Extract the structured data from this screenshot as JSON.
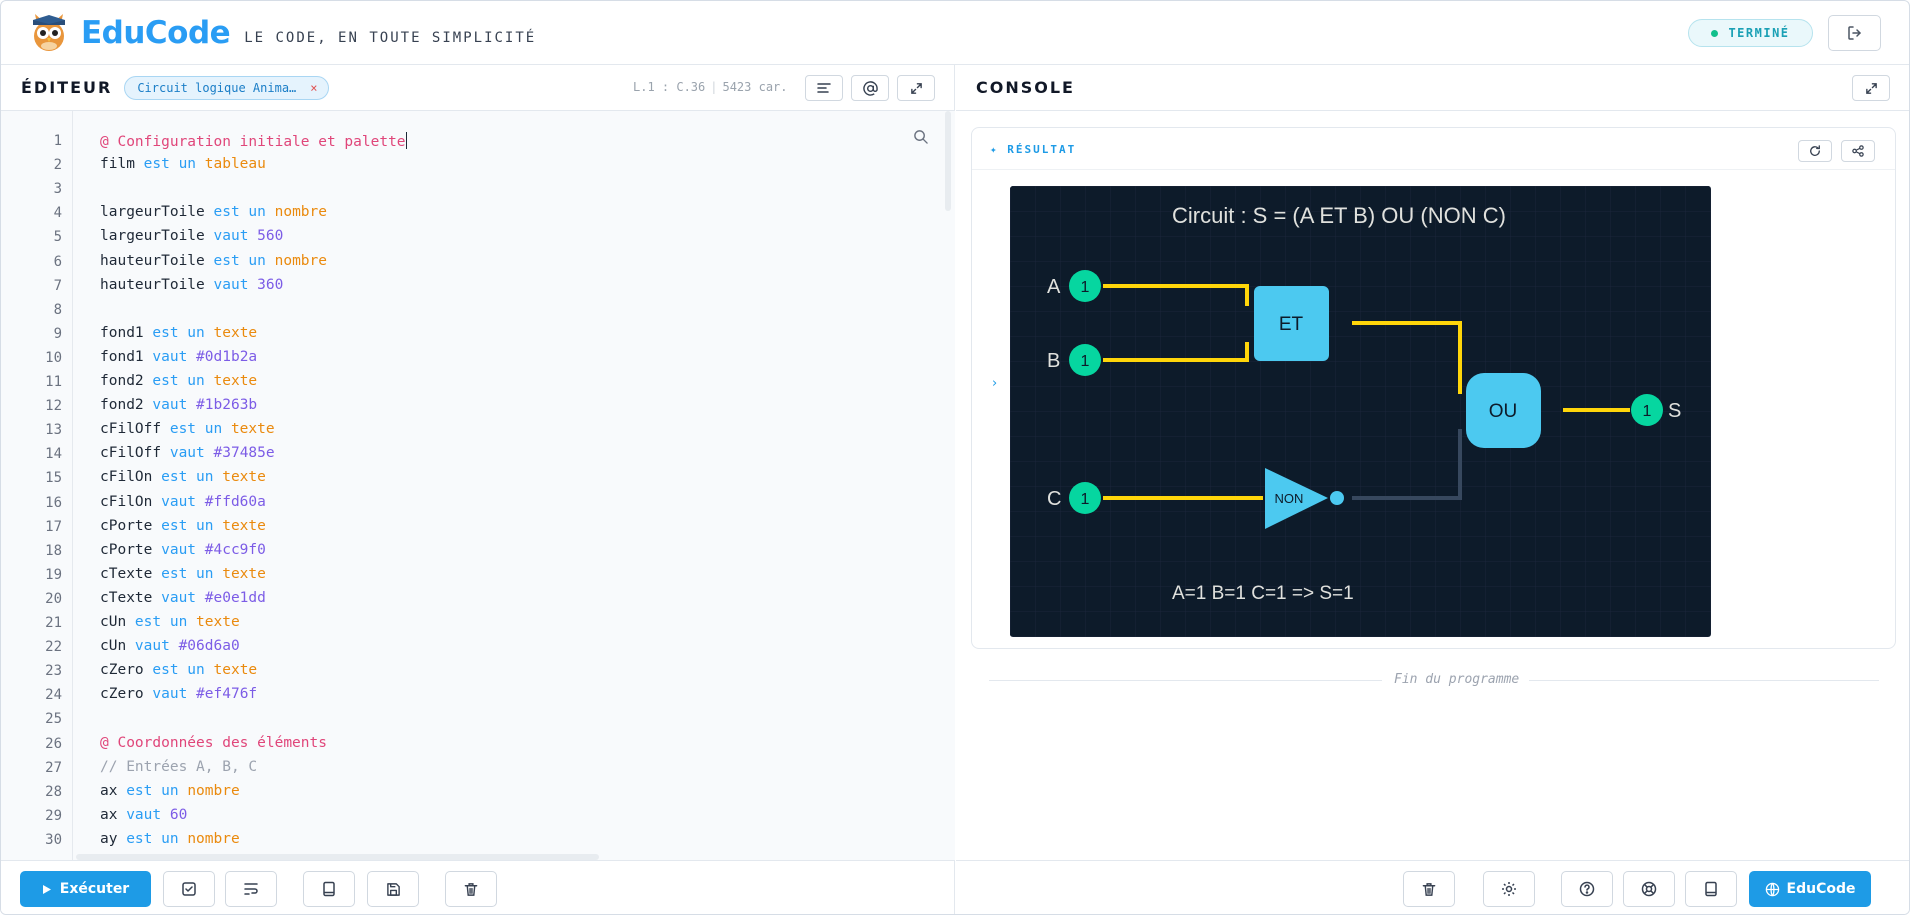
{
  "header": {
    "brand": "EduCode",
    "tagline": "LE CODE, EN TOUTE SIMPLICITÉ",
    "status": "TERMINÉ"
  },
  "editor": {
    "title": "ÉDITEUR",
    "file_tab": "Circuit logique Anima…",
    "file_close": "×",
    "cursor": "L.1 : C.36",
    "chars": "5423 car.",
    "line_numbers": [
      "1",
      "2",
      "3",
      "4",
      "5",
      "6",
      "7",
      "8",
      "9",
      "10",
      "11",
      "12",
      "13",
      "14",
      "15",
      "16",
      "17",
      "18",
      "19",
      "20",
      "21",
      "22",
      "23",
      "24",
      "25",
      "26",
      "27",
      "28",
      "29",
      "30"
    ],
    "lines": [
      [
        [
          "c",
          "@ Configuration initiale et palette"
        ]
      ],
      [
        [
          "p",
          "film "
        ],
        [
          "k",
          "est un "
        ],
        [
          "t",
          "tableau"
        ]
      ],
      [],
      [
        [
          "p",
          "largeurToile "
        ],
        [
          "k",
          "est un "
        ],
        [
          "t",
          "nombre"
        ]
      ],
      [
        [
          "p",
          "largeurToile "
        ],
        [
          "k",
          "vaut "
        ],
        [
          "n",
          "560"
        ]
      ],
      [
        [
          "p",
          "hauteurToile "
        ],
        [
          "k",
          "est un "
        ],
        [
          "t",
          "nombre"
        ]
      ],
      [
        [
          "p",
          "hauteurToile "
        ],
        [
          "k",
          "vaut "
        ],
        [
          "n",
          "360"
        ]
      ],
      [],
      [
        [
          "p",
          "fond1 "
        ],
        [
          "k",
          "est un "
        ],
        [
          "t",
          "texte"
        ]
      ],
      [
        [
          "p",
          "fond1 "
        ],
        [
          "k",
          "vaut "
        ],
        [
          "n",
          "#0d1b2a"
        ]
      ],
      [
        [
          "p",
          "fond2 "
        ],
        [
          "k",
          "est un "
        ],
        [
          "t",
          "texte"
        ]
      ],
      [
        [
          "p",
          "fond2 "
        ],
        [
          "k",
          "vaut "
        ],
        [
          "n",
          "#1b263b"
        ]
      ],
      [
        [
          "p",
          "cFilOff "
        ],
        [
          "k",
          "est un "
        ],
        [
          "t",
          "texte"
        ]
      ],
      [
        [
          "p",
          "cFilOff "
        ],
        [
          "k",
          "vaut "
        ],
        [
          "n",
          "#37485e"
        ]
      ],
      [
        [
          "p",
          "cFilOn "
        ],
        [
          "k",
          "est un "
        ],
        [
          "t",
          "texte"
        ]
      ],
      [
        [
          "p",
          "cFilOn "
        ],
        [
          "k",
          "vaut "
        ],
        [
          "n",
          "#ffd60a"
        ]
      ],
      [
        [
          "p",
          "cPorte "
        ],
        [
          "k",
          "est un "
        ],
        [
          "t",
          "texte"
        ]
      ],
      [
        [
          "p",
          "cPorte "
        ],
        [
          "k",
          "vaut "
        ],
        [
          "n",
          "#4cc9f0"
        ]
      ],
      [
        [
          "p",
          "cTexte "
        ],
        [
          "k",
          "est un "
        ],
        [
          "t",
          "texte"
        ]
      ],
      [
        [
          "p",
          "cTexte "
        ],
        [
          "k",
          "vaut "
        ],
        [
          "n",
          "#e0e1dd"
        ]
      ],
      [
        [
          "p",
          "cUn "
        ],
        [
          "k",
          "est un "
        ],
        [
          "t",
          "texte"
        ]
      ],
      [
        [
          "p",
          "cUn "
        ],
        [
          "k",
          "vaut "
        ],
        [
          "n",
          "#06d6a0"
        ]
      ],
      [
        [
          "p",
          "cZero "
        ],
        [
          "k",
          "est un "
        ],
        [
          "t",
          "texte"
        ]
      ],
      [
        [
          "p",
          "cZero "
        ],
        [
          "k",
          "vaut "
        ],
        [
          "n",
          "#ef476f"
        ]
      ],
      [],
      [
        [
          "c",
          "@ Coordonnées des éléments"
        ]
      ],
      [
        [
          "g",
          "// Entrées A, B, C"
        ]
      ],
      [
        [
          "p",
          "ax "
        ],
        [
          "k",
          "est un "
        ],
        [
          "t",
          "nombre"
        ]
      ],
      [
        [
          "p",
          "ax "
        ],
        [
          "k",
          "vaut "
        ],
        [
          "n",
          "60"
        ]
      ],
      [
        [
          "p",
          "ay "
        ],
        [
          "k",
          "est un "
        ],
        [
          "t",
          "nombre"
        ]
      ]
    ],
    "run_label": "Exécuter"
  },
  "console": {
    "title": "CONSOLE",
    "result_label": "✦ RÉSULTAT",
    "end_text": "Fin du programme",
    "educode_label": "EduCode"
  },
  "circuit": {
    "title": "Circuit : S = (A ET B) OU (NON C)",
    "label_a": "A",
    "label_b": "B",
    "label_c": "C",
    "label_s": "S",
    "value_a": "1",
    "value_b": "1",
    "value_c": "1",
    "value_s": "1",
    "gate_and": "ET",
    "gate_or": "OU",
    "gate_not": "NON",
    "status_line": "A=1 B=1 C=1 => S=1",
    "colors": {
      "background": "#0d1b2a",
      "grid": "#1b263b",
      "wire_on": "#ffd60a",
      "wire_off": "#37485e",
      "gate": "#4cc9f0",
      "text": "#e0e1dd",
      "one": "#06d6a0"
    }
  }
}
